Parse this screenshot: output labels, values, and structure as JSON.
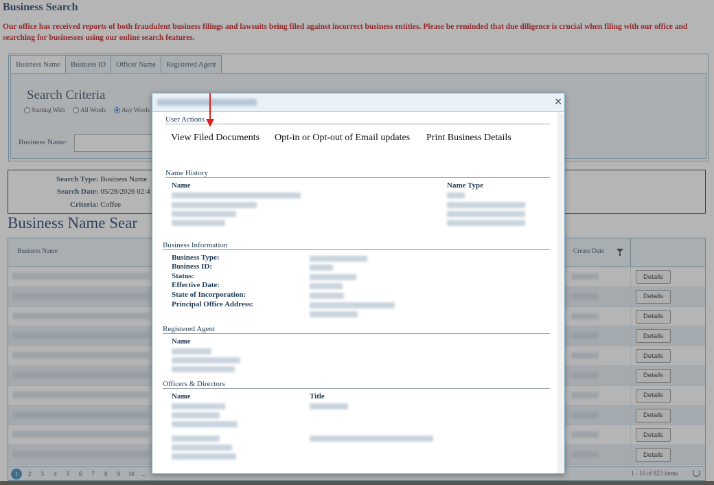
{
  "page": {
    "title": "Business Search",
    "warning": "Our office has received reports of both fraudulent business filings and lawsuits being filed against incorrect business entities. Please be reminded that due diligence is crucial when filing with our office and searching for businesses using our online search features."
  },
  "tabs": [
    "Business Name",
    "Business ID",
    "Officer Name",
    "Registered Agent"
  ],
  "search": {
    "title": "Search Criteria",
    "options": [
      "Starting With",
      "All Words",
      "Any Words"
    ],
    "field_label": "Business Name:"
  },
  "summary": {
    "type_label": "Search Type:",
    "type_value": "Business Name",
    "date_label": "Search Date:",
    "date_value": "05/28/2026 02:4",
    "criteria_label": "Criteria:",
    "criteria_value": "Coffee"
  },
  "results": {
    "title": "Business Name Sear",
    "col_name": "Business Name",
    "col_date": "Create Date",
    "details_label": "Details",
    "row_count": 10
  },
  "pager": {
    "pages": [
      "1",
      "2",
      "3",
      "4",
      "5",
      "6",
      "7",
      "8",
      "9",
      "10",
      "..."
    ],
    "summary": "1 - 10 of 823 items"
  },
  "modal": {
    "close": "×",
    "user_actions": "User Actions",
    "actions": {
      "view_filed": "View Filed Documents",
      "opt": "Opt-in or Opt-out of Email updates",
      "print": "Print Business Details"
    },
    "name_history": {
      "title": "Name History",
      "col_name": "Name",
      "col_type": "Name Type"
    },
    "business_info": {
      "title": "Business Information",
      "labels": [
        "Business Type:",
        "Business ID:",
        "Status:",
        "Effective Date:",
        "State of Incorporation:",
        "Principal Office Address:"
      ]
    },
    "registered_agent": {
      "title": "Registered Agent",
      "col_name": "Name"
    },
    "officers": {
      "title": "Officers & Directors",
      "col_name": "Name",
      "col_title": "Title"
    }
  },
  "colors": {
    "accent": "#0a2a5c",
    "warning": "#c00000",
    "arrow": "#e0221c"
  }
}
